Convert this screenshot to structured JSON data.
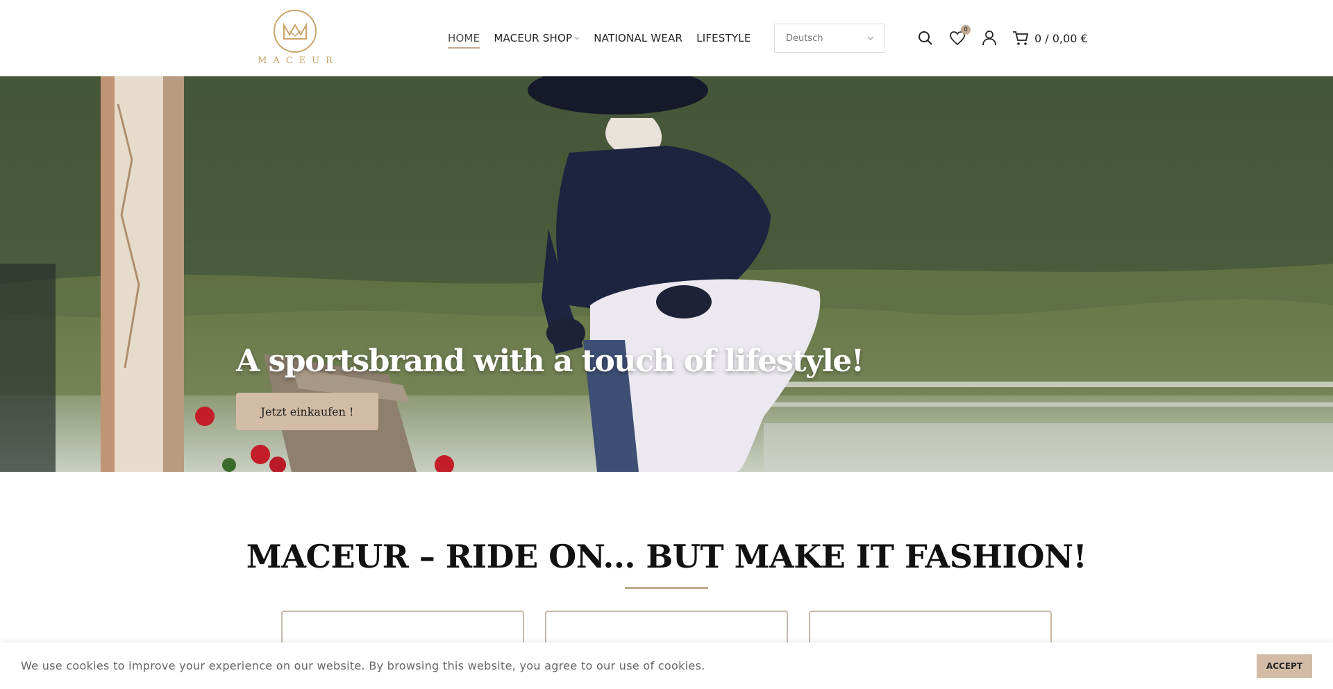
{
  "brand": {
    "name": "MACEUR",
    "accent": "#c9a468",
    "button_color": "#d3bca6"
  },
  "nav": {
    "items": [
      {
        "label": "HOME",
        "active": true
      },
      {
        "label": "MACEUR SHOP",
        "has_dropdown": true
      },
      {
        "label": "NATIONAL WEAR"
      },
      {
        "label": "LIFESTYLE"
      }
    ]
  },
  "language": {
    "selected": "Deutsch"
  },
  "tools": {
    "search_icon": "search-icon",
    "wishlist_icon": "heart-icon",
    "wishlist_count": "0",
    "account_icon": "user-icon",
    "cart_icon": "cart-icon",
    "cart_summary": "0 / 0,00 €"
  },
  "hero": {
    "title": "A sportsbrand with a touch of lifestyle!",
    "cta_label": "Jetzt einkaufen !"
  },
  "section": {
    "title": "MACEUR – RIDE ON... BUT MAKE IT FASHION!"
  },
  "cookie": {
    "text": "We use cookies to improve your experience on our website. By browsing this website, you agree to our use of cookies.",
    "accept_label": "ACCEPT"
  }
}
